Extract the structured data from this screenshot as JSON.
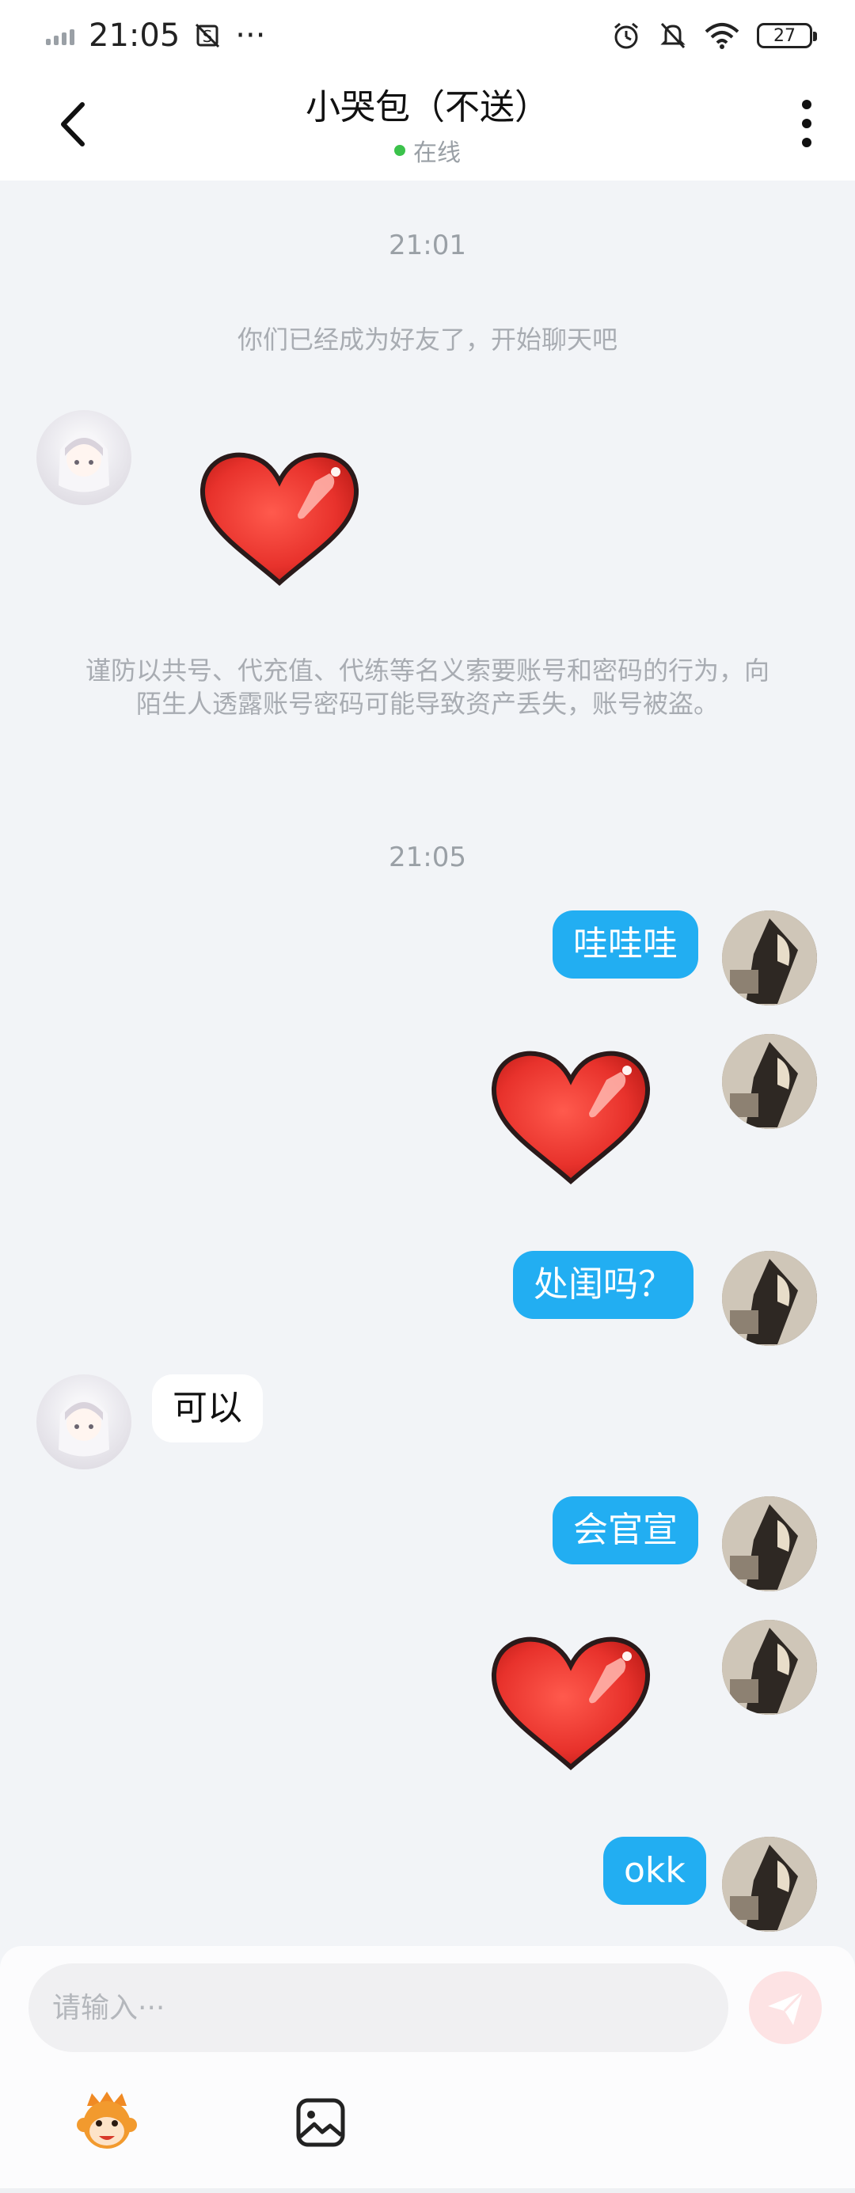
{
  "status_bar": {
    "time": "21:05",
    "extra": "···",
    "battery": "27"
  },
  "header": {
    "title": "小哭包（不送）",
    "status": "在线",
    "accent": "#3bc24b"
  },
  "messages": {
    "time_1": "21:01",
    "system_friend": "你们已经成为好友了，开始聊天吧",
    "system_warning": "谨防以共号、代充值、代练等名义索要账号和密码的行为，向陌生人透露账号密码可能导致资产丢失，账号被盗。",
    "time_2": "21:05",
    "out_1": "哇哇哇",
    "out_2": "处闺吗？",
    "in_1": "可以",
    "out_3": "会官宣",
    "out_4": "okk"
  },
  "input": {
    "placeholder": "请输入···"
  },
  "colors": {
    "bubble_out": "#22aef2",
    "bubble_in": "#ffffff",
    "send_bg": "#fde3e4",
    "heart": "#e8322c"
  }
}
